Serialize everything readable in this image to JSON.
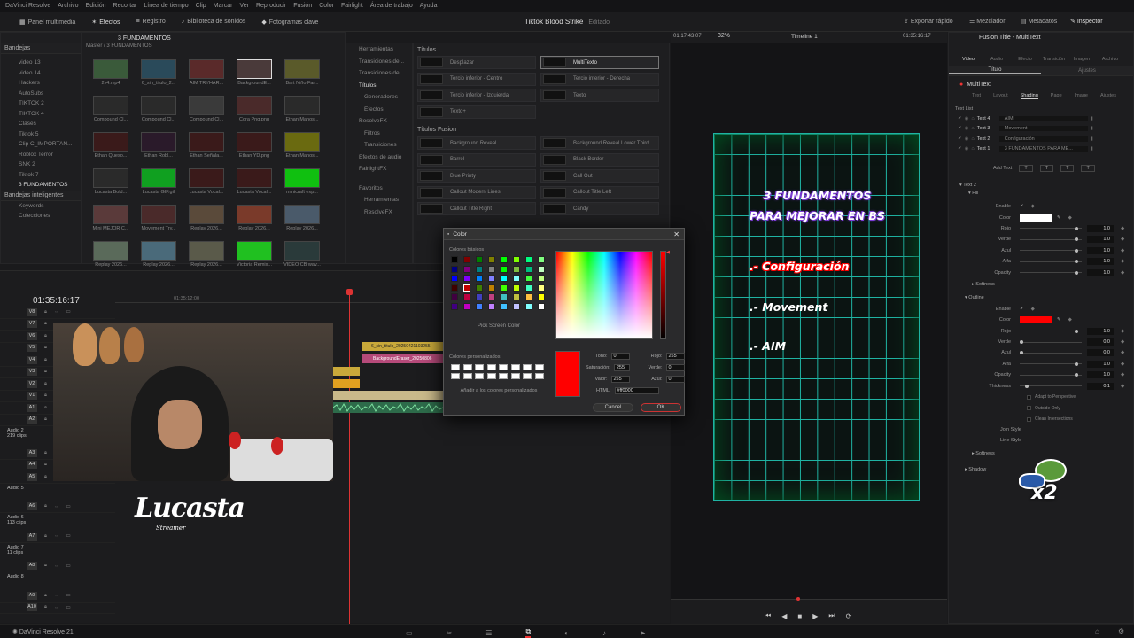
{
  "menubar": {
    "items": [
      "DaVinci Resolve",
      "Archivo",
      "Edición",
      "Recortar",
      "Línea de tiempo",
      "Clip",
      "Marcar",
      "Ver",
      "Reproducir",
      "Fusión",
      "Color",
      "Fairlight",
      "Área de trabajo",
      "Ayuda"
    ]
  },
  "toolbar": {
    "media_pool": "Panel multimedia",
    "effects": "Efectos",
    "index": "Registro",
    "sound_library": "Biblioteca de sonidos",
    "keyframes": "Fotogramas clave",
    "project": "Tiktok Blood Strike",
    "project_status": "Editado",
    "quick_export": "Exportar rápido",
    "mixer": "Mezclador",
    "metadata": "Metadatos",
    "inspector": "Inspector"
  },
  "bins": {
    "header": "Bandejas",
    "items": [
      "video 13",
      "video 14",
      "Hackers",
      "AutoSubs",
      "TIKTOK 2",
      "TIKTOK 4",
      "Clases",
      "Tiktok 5",
      "Clip C_IMPORTAN...",
      "Roblox Terror",
      "SNK 2",
      "Tiktok 7",
      "3 FUNDAMENTOS"
    ],
    "smart_header": "Bandejas inteligentes",
    "smart_items": [
      "Keywords",
      "Colecciones"
    ]
  },
  "media": {
    "path": "Master / 3 FUNDAMENTOS",
    "current_bin": "3 FUNDAMENTOS",
    "clips": [
      "2v4.mp4",
      "6_sin_titulo_2...",
      "AIM TRYHAR...",
      "BackgroundE...",
      "Bart Niño Far...",
      "Compound Cl...",
      "Compound Cl...",
      "Compound Cl...",
      "Cora Png.png",
      "Ethan Manos...",
      "Ethan Queso...",
      "Ethan Robl...",
      "Ethan Señala...",
      "Ethan YD.png",
      "Ethan Manos...",
      "Lucasta Bold...",
      "Lucasta GIF.gif",
      "Lucasta Vocal...",
      "Lucasta Vocal...",
      "minicraft exp...",
      "Mini MEJOR C...",
      "Movement Try...",
      "Replay 2026...",
      "Replay 2026...",
      "Replay 2026...",
      "Replay 2026...",
      "Replay 2026...",
      "Replay 2026...",
      "Victoria Remix...",
      "VIDEO CB wav..."
    ]
  },
  "effects_tree": {
    "items": [
      "Herramientas",
      "Transiciones de...",
      "Transiciones de...",
      "Títulos",
      "Generadores",
      "Efectos",
      "ResolveFX",
      "Filtros",
      "Transiciones",
      "Efectos de audio",
      "FairlightFX"
    ],
    "favorites": "Favoritos",
    "fav_items": [
      "Herramientas",
      "ResolveFX"
    ]
  },
  "titles": {
    "header": "Títulos",
    "items": [
      "Desplazar",
      "MultiTexto",
      "Tercio inferior - Centro",
      "Tercio inferior - Derecha",
      "Tercio inferior - Izquierda",
      "Texto",
      "Texto+"
    ],
    "fusion_header": "Títulos Fusion",
    "fusion_items": [
      "Background Reveal",
      "Background Reveal Lower Third",
      "Barrel",
      "Black Border",
      "Blue Printy",
      "Call Out",
      "Callout Modern Lines",
      "Callout Title Left",
      "Callout Title Right",
      "Candy"
    ]
  },
  "timeline": {
    "timecode": "01:35:16:17",
    "ruler_mark": "01:35:12:00",
    "tracks": [
      "V8",
      "V7",
      "V6",
      "V5",
      "V4",
      "V3",
      "V2",
      "V1",
      "A1",
      "A2",
      "A3",
      "A4",
      "A5",
      "A6",
      "A7",
      "A8",
      "A9",
      "A10"
    ],
    "audio_labels": [
      {
        "name": "Audio 2",
        "clips": "219 clips"
      },
      {
        "name": "Audio 5",
        "clips": ""
      },
      {
        "name": "Audio 6",
        "clips": "113 clips"
      },
      {
        "name": "Audio 7",
        "clips": "11 clips"
      },
      {
        "name": "Audio 8",
        "clips": ""
      }
    ],
    "clip1": "6_sin_titulo_20250421103255",
    "clip2": "BackgroundEraser_20250806"
  },
  "watermark": {
    "name": "Lucasta",
    "sub": "Streamer"
  },
  "viewer": {
    "zoom": "32%",
    "left_tc": "01:17:43:07",
    "timeline_name": "Timeline 1",
    "right_tc": "01:35:16:17",
    "title_line1": "3 FUNDAMENTOS",
    "title_line2": "PARA MEJORAR EN BS",
    "item1": ".- Configuración",
    "item2": ".- Movement",
    "item3": ".- AIM"
  },
  "inspector": {
    "header": "Fusion Title - MultiText",
    "tabs": [
      "Video",
      "Audio",
      "Efecto",
      "Transición",
      "Imagen",
      "Archivo"
    ],
    "subtabs": [
      "Título",
      "Ajustes"
    ],
    "node": "MultiText",
    "inner_tabs": [
      "Text",
      "Layout",
      "Shading",
      "Page",
      "Image",
      "Ajustes"
    ],
    "text_list_label": "Text List",
    "text_list": [
      {
        "name": "Text 4",
        "value": "AIM"
      },
      {
        "name": "Text 3",
        "value": "Movement"
      },
      {
        "name": "Text 2",
        "value": "Configuración"
      },
      {
        "name": "Text 1",
        "value": "3 FUNDAMENTOS PARA ME..."
      }
    ],
    "add_text": "Add Text",
    "text2": "Text 2",
    "fill": "Fill",
    "fill_rows": [
      {
        "k": "Enable",
        "v": ""
      },
      {
        "k": "Color",
        "v": ""
      },
      {
        "k": "Rojo",
        "v": "1.0"
      },
      {
        "k": "Verde",
        "v": "1.0"
      },
      {
        "k": "Azul",
        "v": "1.0"
      },
      {
        "k": "Alfa",
        "v": "1.0"
      },
      {
        "k": "Opacity",
        "v": "1.0"
      }
    ],
    "softness": "Softness",
    "outline": "Outline",
    "outline_rows": [
      {
        "k": "Enable",
        "v": ""
      },
      {
        "k": "Color",
        "v": ""
      },
      {
        "k": "Rojo",
        "v": "1.0"
      },
      {
        "k": "Verde",
        "v": "0.0"
      },
      {
        "k": "Azul",
        "v": "0.0"
      },
      {
        "k": "Alfa",
        "v": "1.0"
      },
      {
        "k": "Opacity",
        "v": "1.0"
      },
      {
        "k": "Thickness",
        "v": "0.1"
      }
    ],
    "checks": [
      "Adapt to Perspective",
      "Outside Only",
      "Clean Intersections"
    ],
    "join_style": "Join Style",
    "line_style": "Line Style",
    "softness2": "Softness",
    "shadow": "Shadow",
    "fill_color": "#ffffff",
    "outline_color": "#ff0000",
    "sticker": "x2"
  },
  "dialog": {
    "title": "Color",
    "basic_label": "Colores básicos",
    "pick_screen": "Pick Screen Color",
    "custom_label": "Colores personalizados",
    "add_custom": "Añadir a los colores personalizados",
    "fields_left": [
      {
        "k": "Tono:",
        "v": "0"
      },
      {
        "k": "Saturación:",
        "v": "255"
      },
      {
        "k": "Valor:",
        "v": "255"
      }
    ],
    "fields_right": [
      {
        "k": "Rojo:",
        "v": "255"
      },
      {
        "k": "Verde:",
        "v": "0"
      },
      {
        "k": "Azul:",
        "v": "0"
      }
    ],
    "html_label": "HTML:",
    "html_value": "#ff0000",
    "cancel": "Cancel",
    "ok": "OK",
    "current_color": "#ff0000",
    "swatches": [
      "#000000",
      "#800000",
      "#008000",
      "#808000",
      "#00ff00",
      "#80ff00",
      "#00ff80",
      "#80ff80",
      "#000080",
      "#800080",
      "#008080",
      "#808080",
      "#00ff00",
      "#80c040",
      "#00c080",
      "#c0ffc0",
      "#0000ff",
      "#8000ff",
      "#0080ff",
      "#8080ff",
      "#00ffff",
      "#80ffff",
      "#40ff40",
      "#c0ff80",
      "#400000",
      "#c00000",
      "#408000",
      "#c08000",
      "#40ff00",
      "#c0ff00",
      "#40ffc0",
      "#ffff80",
      "#400040",
      "#c00040",
      "#4040c0",
      "#c04080",
      "#40c0c0",
      "#c0c040",
      "#ffc040",
      "#ffff00",
      "#400080",
      "#c000c0",
      "#4080ff",
      "#c080ff",
      "#40c0ff",
      "#c0c0ff",
      "#80ffff",
      "#ffffff"
    ]
  },
  "bottombar": {
    "app": "DaVinci Resolve 21"
  }
}
